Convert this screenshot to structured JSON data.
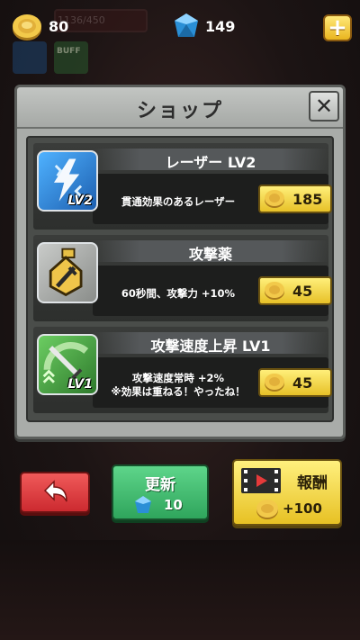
{
  "hud": {
    "coins": "80",
    "gems": "149",
    "hp_text": "1136/450",
    "buff_label": "BUFF"
  },
  "shop": {
    "title": "ショップ",
    "close_icon": "close-icon",
    "items": [
      {
        "name": "レーザー LV2",
        "description": "貫通効果のあるレーザー",
        "price": "185",
        "level_badge": "LV2",
        "icon": "lightning-icon",
        "icon_color": "#2e7ed6"
      },
      {
        "name": "攻撃薬",
        "description": "60秒間、攻撃力 +10%",
        "price": "45",
        "level_badge": "",
        "icon": "potion-icon",
        "icon_color": "#8a8d8a"
      },
      {
        "name": "攻撃速度上昇 LV1",
        "description_line1": "攻撃速度常時 +2%",
        "description_line2": "※効果は重ねる！やったね！",
        "price": "45",
        "level_badge": "LV1",
        "icon": "sword-speed-icon",
        "icon_color": "#3f9a3c"
      }
    ]
  },
  "buttons": {
    "back_icon": "back-arrow-icon",
    "refresh_label": "更新",
    "refresh_cost": "10",
    "reward_label": "報酬",
    "reward_amount": "+100"
  },
  "colors": {
    "gold": "#e7c128",
    "green": "#2fa55c",
    "red": "#cc2a30",
    "panel": "#a9aca9"
  }
}
